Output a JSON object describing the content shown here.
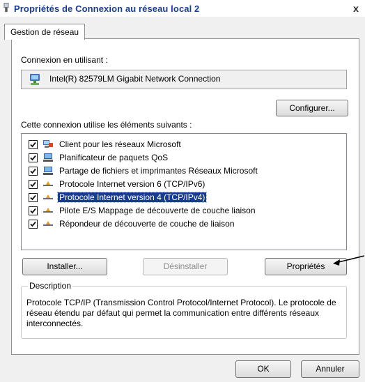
{
  "window": {
    "title": "Propriétés de Connexion au réseau local 2",
    "close": "x"
  },
  "tabs": [
    {
      "label": "Gestion de réseau"
    }
  ],
  "connection": {
    "label": "Connexion en utilisant :",
    "adapter": "Intel(R) 82579LM Gigabit Network Connection",
    "configure_label": "Configurer..."
  },
  "items_label": "Cette connexion utilise les éléments suivants :",
  "items": [
    {
      "label": "Client pour les réseaux Microsoft",
      "checked": true,
      "icon": "network-client-icon"
    },
    {
      "label": "Planificateur de paquets QoS",
      "checked": true,
      "icon": "computer-icon"
    },
    {
      "label": "Partage de fichiers et imprimantes Réseaux Microsoft",
      "checked": true,
      "icon": "computer-icon"
    },
    {
      "label": "Protocole Internet version 6 (TCP/IPv6)",
      "checked": true,
      "icon": "protocol-icon"
    },
    {
      "label": "Protocole Internet version 4 (TCP/IPv4)",
      "checked": true,
      "icon": "protocol-icon",
      "selected": true
    },
    {
      "label": "Pilote E/S Mappage de découverte de couche liaison",
      "checked": true,
      "icon": "protocol-icon"
    },
    {
      "label": "Répondeur de découverte de couche de liaison",
      "checked": true,
      "icon": "protocol-icon"
    }
  ],
  "buttons": {
    "install": "Installer...",
    "uninstall": "Désinstaller",
    "properties": "Propriétés",
    "ok": "OK",
    "cancel": "Annuler"
  },
  "description": {
    "legend": "Description",
    "text": "Protocole TCP/IP (Transmission Control Protocol/Internet Protocol). Le protocole de réseau étendu par défaut qui permet la communication entre différents réseaux interconnectés."
  },
  "colors": {
    "title": "#1a3d8a",
    "selection": "#1a3c8e"
  }
}
